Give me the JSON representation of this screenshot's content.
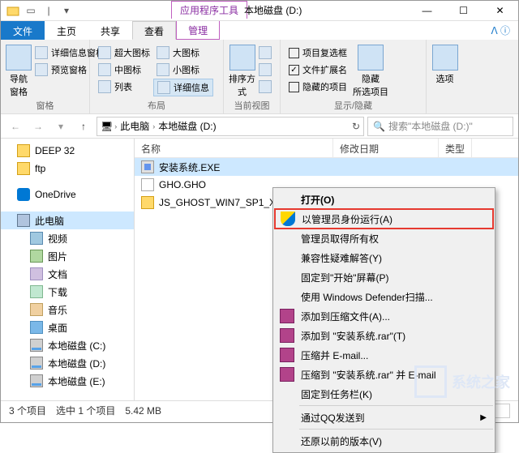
{
  "window": {
    "appToolsLabel": "应用程序工具",
    "title": "本地磁盘 (D:)"
  },
  "tabs": {
    "file": "文件",
    "home": "主页",
    "share": "共享",
    "view": "查看",
    "manage": "管理"
  },
  "ribbon": {
    "panes": {
      "navPane": "导航窗格",
      "detailsPane": "详细信息窗格",
      "previewPane": "预览窗格",
      "groupLabel": "窗格"
    },
    "layout": {
      "xlIcons": "超大图标",
      "lIcons": "大图标",
      "mIcons": "中图标",
      "sIcons": "小图标",
      "list": "列表",
      "details": "详细信息",
      "groupLabel": "布局"
    },
    "current": {
      "sortBy": "排序方式",
      "groupLabel": "当前视图"
    },
    "showhide": {
      "itemChk": "项目复选框",
      "ext": "文件扩展名",
      "hidden": "隐藏的项目",
      "hide": "隐藏\n所选项目",
      "groupLabel": "显示/隐藏"
    },
    "options": "选项"
  },
  "breadcrumb": {
    "pc": "此电脑",
    "drive": "本地磁盘 (D:)"
  },
  "search": {
    "placeholder": "搜索\"本地磁盘 (D:)\""
  },
  "tree": {
    "deep32": "DEEP 32",
    "ftp": "ftp",
    "onedrive": "OneDrive",
    "pc": "此电脑",
    "video": "视频",
    "pictures": "图片",
    "documents": "文档",
    "downloads": "下载",
    "music": "音乐",
    "desktop": "桌面",
    "driveC": "本地磁盘 (C:)",
    "driveD": "本地磁盘 (D:)",
    "driveE": "本地磁盘 (E:)"
  },
  "columns": {
    "name": "名称",
    "modified": "修改日期",
    "type": "类型"
  },
  "files": {
    "exe": "安装系统.EXE",
    "gho": "GHO.GHO",
    "folder": "JS_GHOST_WIN7_SP1_X64_"
  },
  "context": {
    "open": "打开(O)",
    "runAdmin": "以管理员身份运行(A)",
    "ownership": "管理员取得所有权",
    "compat": "兼容性疑难解答(Y)",
    "pinStart": "固定到\"开始\"屏幕(P)",
    "defender": "使用 Windows Defender扫描...",
    "addArchive": "添加到压缩文件(A)...",
    "addRar": "添加到 \"安装系统.rar\"(T)",
    "zipEmail": "压缩并 E-mail...",
    "zipRarEmail": "压缩到 \"安装系统.rar\" 并 E-mail",
    "pinTask": "固定到任务栏(K)",
    "qqSend": "通过QQ发送到",
    "restore": "还原以前的版本(V)"
  },
  "status": {
    "count": "3 个项目",
    "selected": "选中 1 个项目",
    "size": "5.42 MB"
  },
  "watermark": "系统之家"
}
